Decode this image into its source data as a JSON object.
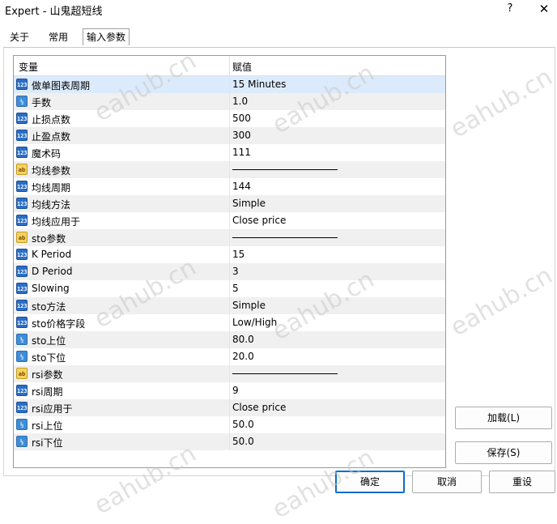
{
  "window": {
    "title": "Expert - 山鬼超短线",
    "help": "?",
    "close": "✕"
  },
  "tabs": [
    {
      "label": "关于"
    },
    {
      "label": "常用"
    },
    {
      "label": "输入参数"
    }
  ],
  "table": {
    "col_variable": "变量",
    "col_value": "赋值",
    "rows": [
      {
        "icon": "int-icon",
        "icon_text": "123",
        "name": "做单图表周期",
        "value": "15 Minutes"
      },
      {
        "icon": "double-icon",
        "icon_text": "½",
        "name": "手数",
        "value": "1.0"
      },
      {
        "icon": "int-icon",
        "icon_text": "123",
        "name": "止损点数",
        "value": "500"
      },
      {
        "icon": "int-icon",
        "icon_text": "123",
        "name": "止盈点数",
        "value": "300"
      },
      {
        "icon": "int-icon",
        "icon_text": "123",
        "name": "魔术码",
        "value": "111"
      },
      {
        "icon": "string-icon",
        "icon_text": "ab",
        "name": "均线参数",
        "value": ""
      },
      {
        "icon": "int-icon",
        "icon_text": "123",
        "name": "均线周期",
        "value": "144"
      },
      {
        "icon": "int-icon",
        "icon_text": "123",
        "name": "均线方法",
        "value": "Simple"
      },
      {
        "icon": "int-icon",
        "icon_text": "123",
        "name": "均线应用于",
        "value": "Close price"
      },
      {
        "icon": "string-icon",
        "icon_text": "ab",
        "name": "sto参数",
        "value": ""
      },
      {
        "icon": "int-icon",
        "icon_text": "123",
        "name": "K Period",
        "value": "15"
      },
      {
        "icon": "int-icon",
        "icon_text": "123",
        "name": "D Period",
        "value": "3"
      },
      {
        "icon": "int-icon",
        "icon_text": "123",
        "name": "Slowing",
        "value": "5"
      },
      {
        "icon": "int-icon",
        "icon_text": "123",
        "name": "sto方法",
        "value": "Simple"
      },
      {
        "icon": "int-icon",
        "icon_text": "123",
        "name": "sto价格字段",
        "value": "Low/High"
      },
      {
        "icon": "double-icon",
        "icon_text": "½",
        "name": "sto上位",
        "value": "80.0"
      },
      {
        "icon": "double-icon",
        "icon_text": "½",
        "name": "sto下位",
        "value": "20.0"
      },
      {
        "icon": "string-icon",
        "icon_text": "ab",
        "name": "rsi参数",
        "value": ""
      },
      {
        "icon": "int-icon",
        "icon_text": "123",
        "name": "rsi周期",
        "value": "9"
      },
      {
        "icon": "int-icon",
        "icon_text": "123",
        "name": "rsi应用于",
        "value": "Close price"
      },
      {
        "icon": "double-icon",
        "icon_text": "½",
        "name": "rsi上位",
        "value": "50.0"
      },
      {
        "icon": "double-icon",
        "icon_text": "½",
        "name": "rsi下位",
        "value": "50.0"
      }
    ]
  },
  "buttons": {
    "load": "加载(L)",
    "save": "保存(S)",
    "ok": "确定",
    "cancel": "取消",
    "reset": "重设"
  },
  "watermark": "eahub.cn",
  "colors": {
    "selected_row": "#dcebfc",
    "alt_row": "#f0f0f0",
    "primary_border": "#0a6dc9"
  }
}
